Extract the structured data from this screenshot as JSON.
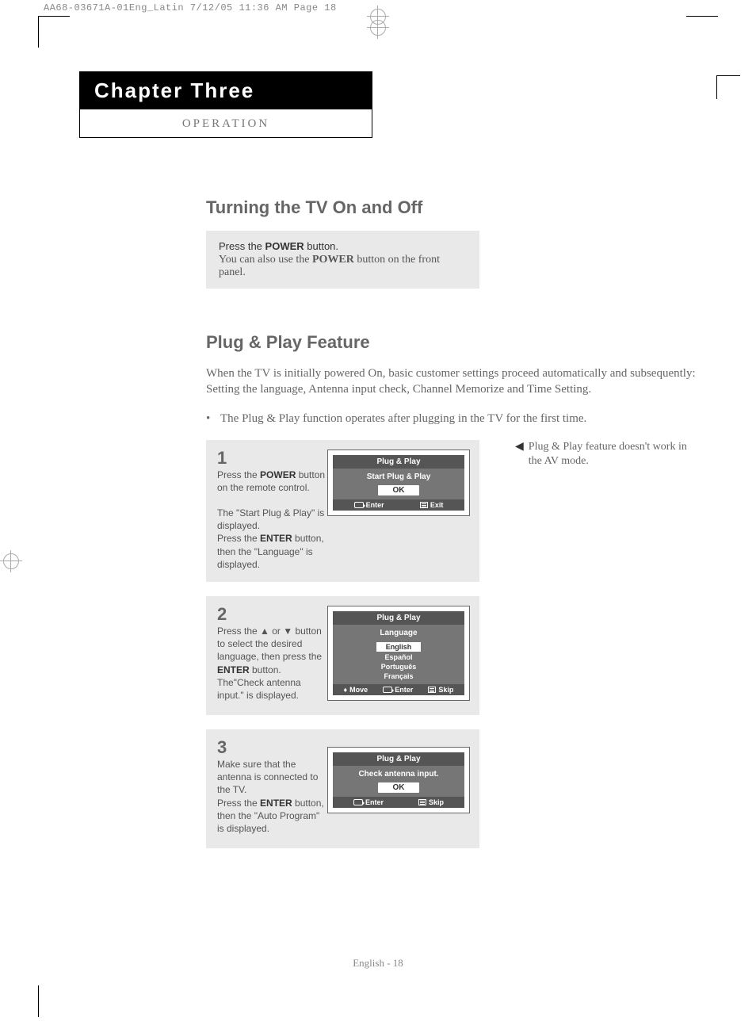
{
  "header_meta": "AA68-03671A-01Eng_Latin  7/12/05  11:36 AM  Page 18",
  "chapter": {
    "title": "Chapter Three",
    "subtitle": "OPERATION"
  },
  "section1": {
    "heading": "Turning the TV On and Off",
    "box_line1_pre": "Press the ",
    "box_line1_bold": "POWER",
    "box_line1_post": " button.",
    "box_line2_pre": "You can also use the ",
    "box_line2_bold": "POWER",
    "box_line2_post": " button on the front panel."
  },
  "section2": {
    "heading": "Plug & Play Feature",
    "desc": "When the TV is initially powered On, basic customer settings proceed automatically and subsequently: Setting the language, Antenna input check, Channel Memorize and Time Setting.",
    "bullet": "The Plug & Play function operates after plugging in the TV for the first time.",
    "sidenote": "Plug & Play feature doesn't work in the AV mode."
  },
  "steps": [
    {
      "num": "1",
      "text_html": "Press the <b>POWER</b> button on the remote control.<br><br>The \"Start Plug & Play\" is displayed.<br>Press the <b>ENTER</b> button, then the \"Language\" is displayed.",
      "osd": {
        "title": "Plug & Play",
        "sub": "Start Plug & Play",
        "button": "OK",
        "foot": [
          {
            "icon": "enter",
            "label": "Enter"
          },
          {
            "icon": "menu",
            "label": "Exit"
          }
        ]
      }
    },
    {
      "num": "2",
      "text_html": "Press the ▲ or ▼ button to select the desired language, then press the <b>ENTER</b> button.<br>The\"Check antenna input.\" is displayed.",
      "osd": {
        "title": "Plug & Play",
        "sub": "Language",
        "list": [
          "English",
          "Español",
          "Português",
          "Français"
        ],
        "selected_index": 0,
        "foot": [
          {
            "icon": "move",
            "label": "Move"
          },
          {
            "icon": "enter",
            "label": "Enter"
          },
          {
            "icon": "menu",
            "label": "Skip"
          }
        ]
      }
    },
    {
      "num": "3",
      "text_html": "Make sure that the antenna is connected to the TV.<br>Press the <b>ENTER</b> button, then the \"Auto Program\" is displayed.",
      "osd": {
        "title": "Plug & Play",
        "sub": "Check antenna input.",
        "button": "OK",
        "foot": [
          {
            "icon": "enter",
            "label": "Enter"
          },
          {
            "icon": "menu",
            "label": "Skip"
          }
        ]
      }
    }
  ],
  "footer": "English - 18"
}
